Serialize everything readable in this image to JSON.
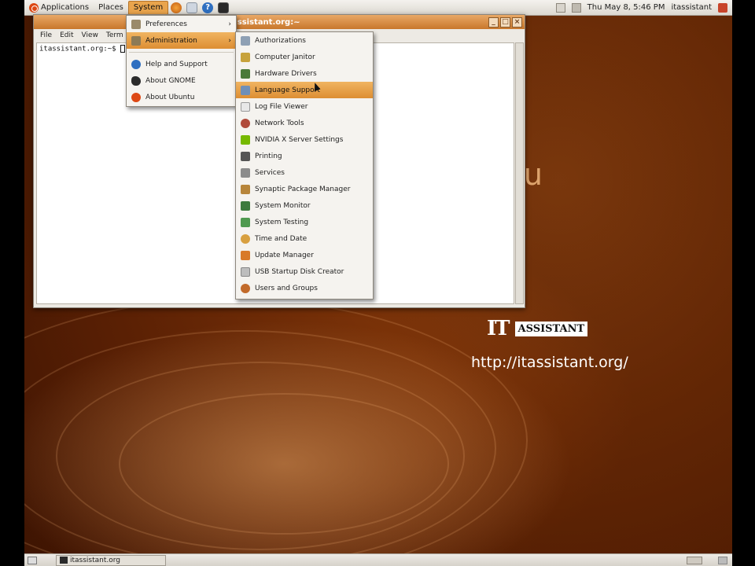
{
  "top_panel": {
    "applications": "Applications",
    "places": "Places",
    "system": "System",
    "clock": "Thu May 8, 5:46 PM",
    "user": "itassistant"
  },
  "terminal": {
    "title": "assistant.org:~",
    "menu": [
      "File",
      "Edit",
      "View",
      "Term"
    ],
    "prompt": "itassistant.org:~$ "
  },
  "system_menu": {
    "items": [
      {
        "label": "Preferences",
        "icon": "preferences-icon",
        "submenu": true
      },
      {
        "label": "Administration",
        "icon": "administration-icon",
        "submenu": true,
        "active": true
      },
      {
        "label": "Help and Support",
        "icon": "help-icon"
      },
      {
        "label": "About GNOME",
        "icon": "gnome-icon"
      },
      {
        "label": "About Ubuntu",
        "icon": "ubuntu-icon"
      }
    ]
  },
  "admin_menu": {
    "items": [
      {
        "label": "Authorizations",
        "icon": "authorizations-icon"
      },
      {
        "label": "Computer Janitor",
        "icon": "janitor-icon"
      },
      {
        "label": "Hardware Drivers",
        "icon": "hardware-icon"
      },
      {
        "label": "Language Support",
        "icon": "language-icon",
        "active": true
      },
      {
        "label": "Log File Viewer",
        "icon": "log-icon"
      },
      {
        "label": "Network Tools",
        "icon": "network-icon"
      },
      {
        "label": "NVIDIA X Server Settings",
        "icon": "nvidia-icon"
      },
      {
        "label": "Printing",
        "icon": "printer-icon"
      },
      {
        "label": "Services",
        "icon": "services-icon"
      },
      {
        "label": "Synaptic Package Manager",
        "icon": "synaptic-icon"
      },
      {
        "label": "System Monitor",
        "icon": "monitor-icon"
      },
      {
        "label": "System Testing",
        "icon": "testing-icon"
      },
      {
        "label": "Time and Date",
        "icon": "clock-icon"
      },
      {
        "label": "Update Manager",
        "icon": "update-icon"
      },
      {
        "label": "USB Startup Disk Creator",
        "icon": "usb-icon"
      },
      {
        "label": "Users and Groups",
        "icon": "users-icon"
      }
    ]
  },
  "desktop": {
    "brand_partial": "tu",
    "logo_glyph": "IT",
    "logo_word": "ASSISTANT",
    "url": "http://itassistant.org/"
  },
  "bottom_panel": {
    "task": "itassistant.org"
  },
  "colors": {
    "highlight": "#e9a44c",
    "wallpaper": "#7a3208"
  }
}
